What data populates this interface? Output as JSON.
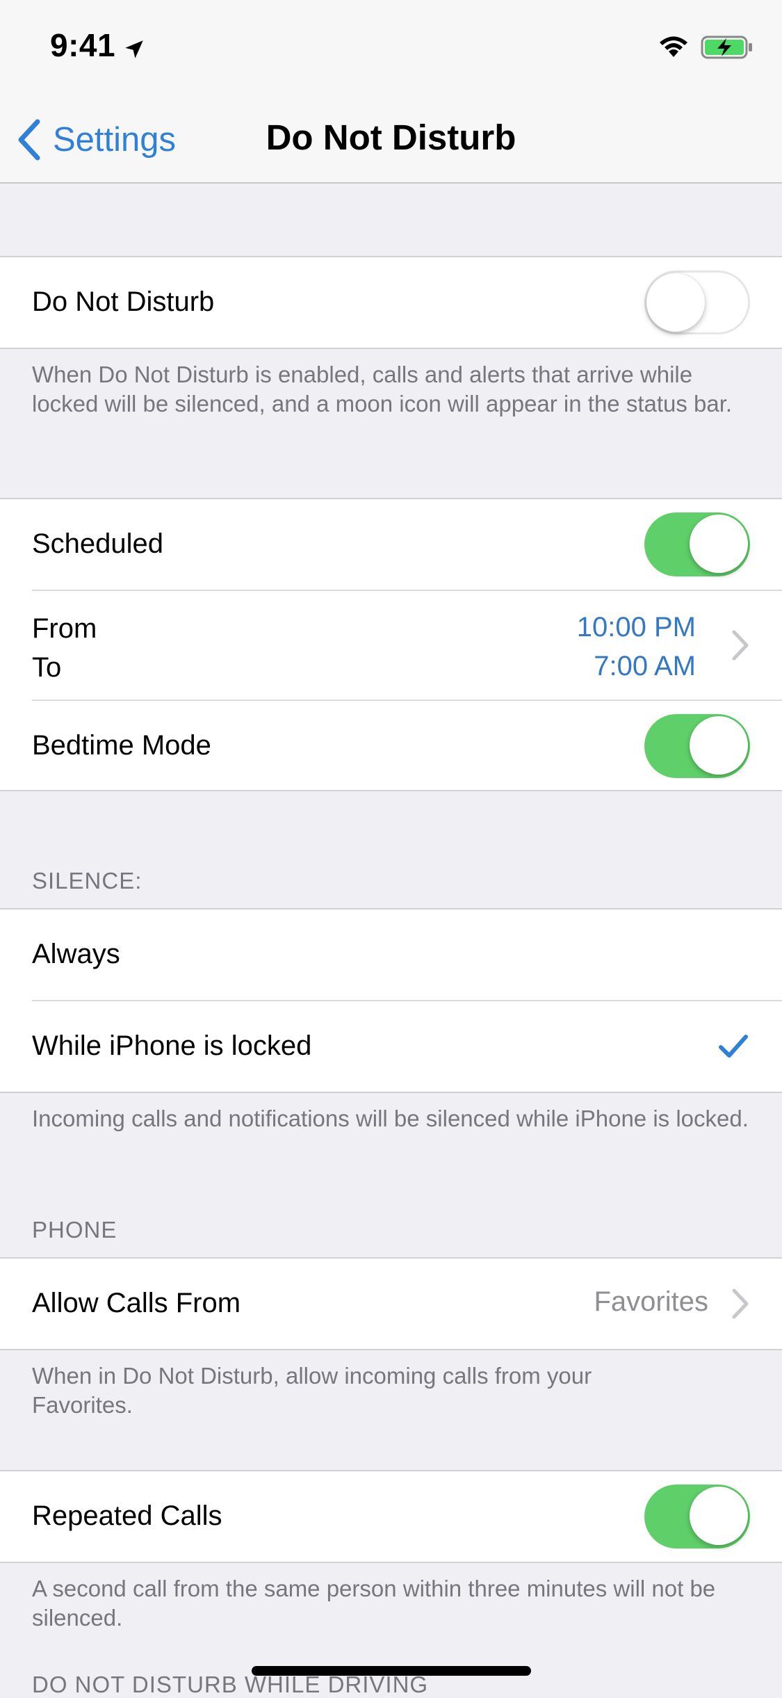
{
  "status_bar": {
    "time": "9:41",
    "icons": [
      "location-arrow-icon",
      "wifi-icon",
      "battery-charging-icon"
    ]
  },
  "nav": {
    "back_label": "Settings",
    "title": "Do Not Disturb"
  },
  "dnd_section": {
    "label": "Do Not Disturb",
    "enabled": false,
    "footer": "When Do Not Disturb is enabled, calls and alerts that arrive while locked will be silenced, and a moon icon will appear in the status bar."
  },
  "schedule_section": {
    "scheduled_label": "Scheduled",
    "scheduled_enabled": true,
    "from_label": "From",
    "to_label": "To",
    "from_value": "10:00 PM",
    "to_value": "7:00 AM",
    "bedtime_label": "Bedtime Mode",
    "bedtime_enabled": true
  },
  "silence_section": {
    "header": "SILENCE:",
    "options": [
      "Always",
      "While iPhone is locked"
    ],
    "selected": "While iPhone is locked",
    "footer": "Incoming calls and notifications will be silenced while iPhone is locked."
  },
  "phone_section": {
    "header": "PHONE",
    "allow_calls_label": "Allow Calls From",
    "allow_calls_value": "Favorites",
    "footer": "When in Do Not Disturb, allow incoming calls from your Favorites."
  },
  "repeated_section": {
    "label": "Repeated Calls",
    "enabled": true,
    "footer": "A second call from the same person within three minutes will not be silenced."
  },
  "driving_section": {
    "header": "DO NOT DISTURB WHILE DRIVING"
  },
  "colors": {
    "accent": "#2f80d8",
    "switch_on": "#5fd069",
    "background": "#efeff4",
    "footer_text": "#76767c"
  }
}
